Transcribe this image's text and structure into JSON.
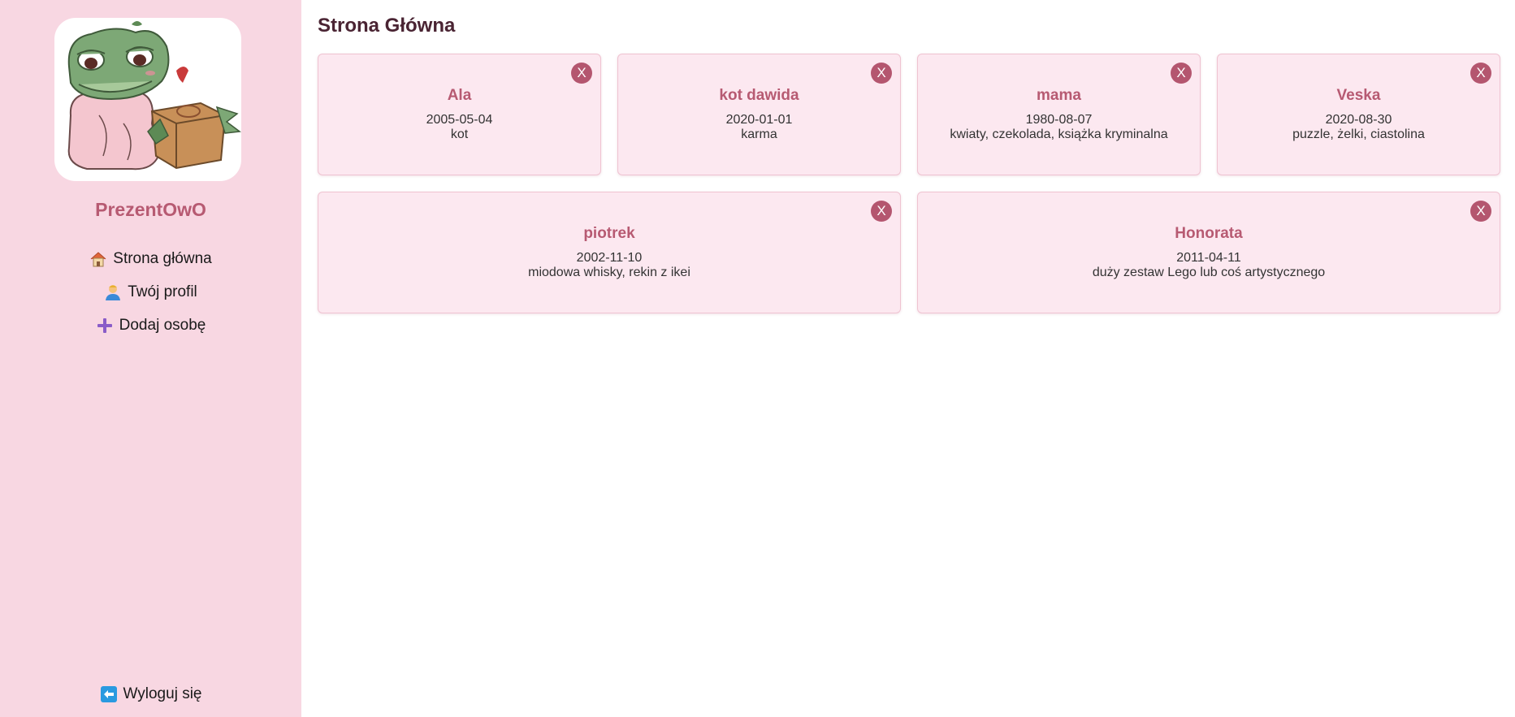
{
  "sidebar": {
    "brand": "PrezentOwO",
    "nav": {
      "home": {
        "label": "Strona główna",
        "icon": "house-icon"
      },
      "profile": {
        "label": "Twój profil",
        "icon": "person-icon"
      },
      "add": {
        "label": "Dodaj osobę",
        "icon": "plus-icon"
      }
    },
    "logout": {
      "label": "Wyloguj się",
      "icon": "arrow-left-icon"
    }
  },
  "main": {
    "title": "Strona Główna",
    "close_label": "X",
    "cards": [
      {
        "name": "Ala",
        "date": "2005-05-04",
        "gifts": "kot"
      },
      {
        "name": "kot dawida",
        "date": "2020-01-01",
        "gifts": "karma"
      },
      {
        "name": "mama",
        "date": "1980-08-07",
        "gifts": "kwiaty, czekolada, książka kryminalna"
      },
      {
        "name": "Veska",
        "date": "2020-08-30",
        "gifts": "puzzle, żelki, ciastolina"
      },
      {
        "name": "piotrek",
        "date": "2002-11-10",
        "gifts": "miodowa whisky, rekin z ikei"
      },
      {
        "name": "Honorata",
        "date": "2011-04-11",
        "gifts": "duży zestaw Lego lub coś artystycznego"
      }
    ]
  },
  "colors": {
    "sidebar_bg": "#f8d7e2",
    "accent": "#b75a72",
    "card_bg": "#fce8f0",
    "close_bg": "#b4566f",
    "title": "#4a2433"
  }
}
